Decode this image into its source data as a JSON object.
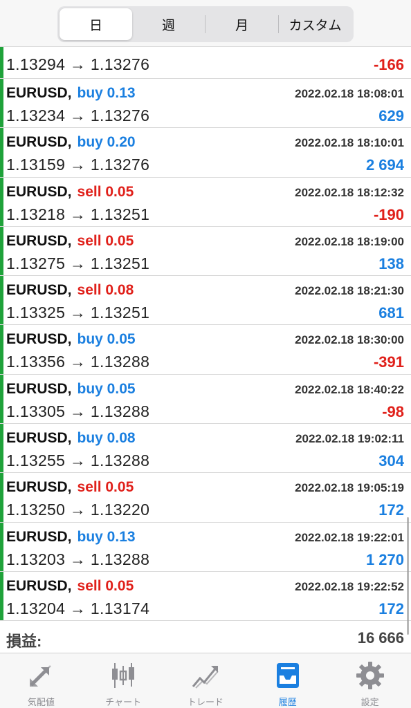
{
  "segments": [
    "日",
    "週",
    "月",
    "カスタム"
  ],
  "active_segment": 0,
  "partial_row": {
    "prices": "1.13294 → 1.13276",
    "profit": "-166",
    "profit_sign": "neg"
  },
  "trades": [
    {
      "symbol": "EURUSD,",
      "side": "buy",
      "side_label": "buy 0.13",
      "time": "2022.02.18 18:08:01",
      "prices": "1.13234 → 1.13276",
      "profit": "629",
      "profit_sign": "pos"
    },
    {
      "symbol": "EURUSD,",
      "side": "buy",
      "side_label": "buy 0.20",
      "time": "2022.02.18 18:10:01",
      "prices": "1.13159 → 1.13276",
      "profit": "2 694",
      "profit_sign": "pos"
    },
    {
      "symbol": "EURUSD,",
      "side": "sell",
      "side_label": "sell 0.05",
      "time": "2022.02.18 18:12:32",
      "prices": "1.13218 → 1.13251",
      "profit": "-190",
      "profit_sign": "neg"
    },
    {
      "symbol": "EURUSD,",
      "side": "sell",
      "side_label": "sell 0.05",
      "time": "2022.02.18 18:19:00",
      "prices": "1.13275 → 1.13251",
      "profit": "138",
      "profit_sign": "pos"
    },
    {
      "symbol": "EURUSD,",
      "side": "sell",
      "side_label": "sell 0.08",
      "time": "2022.02.18 18:21:30",
      "prices": "1.13325 → 1.13251",
      "profit": "681",
      "profit_sign": "pos"
    },
    {
      "symbol": "EURUSD,",
      "side": "buy",
      "side_label": "buy 0.05",
      "time": "2022.02.18 18:30:00",
      "prices": "1.13356 → 1.13288",
      "profit": "-391",
      "profit_sign": "neg"
    },
    {
      "symbol": "EURUSD,",
      "side": "buy",
      "side_label": "buy 0.05",
      "time": "2022.02.18 18:40:22",
      "prices": "1.13305 → 1.13288",
      "profit": "-98",
      "profit_sign": "neg"
    },
    {
      "symbol": "EURUSD,",
      "side": "buy",
      "side_label": "buy 0.08",
      "time": "2022.02.18 19:02:11",
      "prices": "1.13255 → 1.13288",
      "profit": "304",
      "profit_sign": "pos"
    },
    {
      "symbol": "EURUSD,",
      "side": "sell",
      "side_label": "sell 0.05",
      "time": "2022.02.18 19:05:19",
      "prices": "1.13250 → 1.13220",
      "profit": "172",
      "profit_sign": "pos"
    },
    {
      "symbol": "EURUSD,",
      "side": "buy",
      "side_label": "buy 0.13",
      "time": "2022.02.18 19:22:01",
      "prices": "1.13203 → 1.13288",
      "profit": "1 270",
      "profit_sign": "pos"
    },
    {
      "symbol": "EURUSD,",
      "side": "sell",
      "side_label": "sell 0.05",
      "time": "2022.02.18 19:22:52",
      "prices": "1.13204 → 1.13174",
      "profit": "172",
      "profit_sign": "pos"
    }
  ],
  "summary": {
    "label": "損益:",
    "value": "16 666"
  },
  "tabs": [
    {
      "label": "気配値",
      "icon": "quotes-arrows-icon"
    },
    {
      "label": "チャート",
      "icon": "candlestick-chart-icon"
    },
    {
      "label": "トレード",
      "icon": "trade-line-icon"
    },
    {
      "label": "履歴",
      "icon": "history-inbox-icon"
    },
    {
      "label": "設定",
      "icon": "settings-gear-icon"
    }
  ],
  "active_tab": 3,
  "colors": {
    "buy": "#1a7fe0",
    "sell": "#e0201a",
    "profit_positive": "#1a7fe0",
    "profit_negative": "#e0201a",
    "row_marker": "#1fa23a",
    "tab_active": "#1a7fe0",
    "tab_inactive": "#8e8e93"
  }
}
